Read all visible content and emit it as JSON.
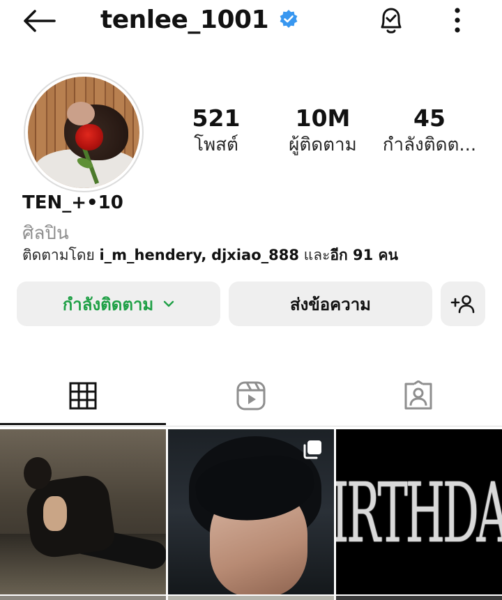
{
  "header": {
    "username": "tenlee_1001",
    "verified": true,
    "icons": {
      "back": "arrow-left-icon",
      "verified": "verified-badge-icon",
      "notifications": "bell-check-icon",
      "more": "more-vertical-icon"
    }
  },
  "profile": {
    "display_name": "TEN_+•10",
    "category": "ศิลปิน",
    "stats": [
      {
        "value": "521",
        "label": "โพสต์"
      },
      {
        "value": "10M",
        "label": "ผู้ติดตาม"
      },
      {
        "value": "45",
        "label": "กำลังติดต..."
      }
    ],
    "followed_by": {
      "prefix": "ติดตามโดย",
      "user1": "i_m_hendery",
      "sep": ",",
      "user2": "djxiao_888",
      "middle": "และ",
      "rest": "อีก 91 คน"
    }
  },
  "actions": {
    "following_label": "กำลังติดตาม",
    "message_label": "ส่งข้อความ",
    "following_color": "#1fa046",
    "icons": {
      "chevron": "chevron-down-icon",
      "add_user": "add-user-icon"
    }
  },
  "tabs": [
    {
      "name": "grid",
      "icon": "grid-icon",
      "active": true
    },
    {
      "name": "reels",
      "icon": "reels-icon",
      "active": false
    },
    {
      "name": "tagged",
      "icon": "tagged-user-icon",
      "active": false
    }
  ],
  "posts": {
    "post3_text": "IRTHDA"
  },
  "colors": {
    "verified_blue": "#3897f0",
    "button_bg": "#efefef",
    "muted_text": "#8e8e8e"
  }
}
